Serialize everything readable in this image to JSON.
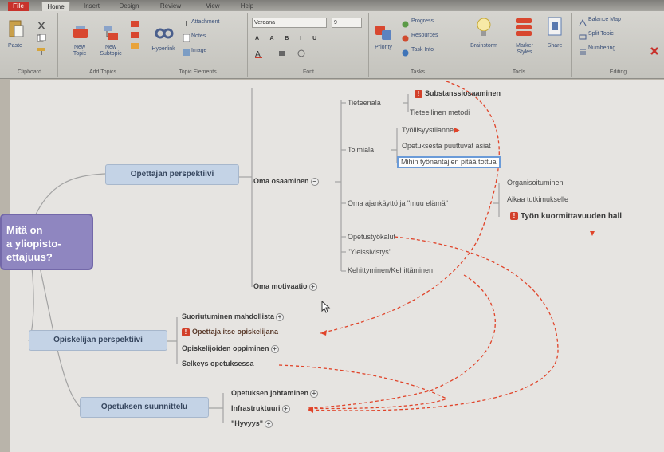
{
  "ribbon_tabs": [
    "File",
    "Home",
    "Insert",
    "Design",
    "Review",
    "View",
    "Help"
  ],
  "groups": {
    "clipboard": {
      "caption": "Clipboard",
      "paste": "Paste"
    },
    "add_topics": {
      "caption": "Add Topics",
      "new_topic": "New Topic",
      "new_subtopic": "New Subtopic"
    },
    "topic_elements": {
      "caption": "Topic Elements",
      "hyperlink": "Hyperlink",
      "attachment": "Attachment",
      "notes": "Notes",
      "image": "Image"
    },
    "font": {
      "caption": "Font",
      "family": "Verdana",
      "size": "9"
    },
    "tasks": {
      "caption": "Tasks",
      "priority": "Priority",
      "progress": "Progress",
      "resources": "Resources",
      "task_info": "Task Info"
    },
    "tools": {
      "caption": "Tools",
      "brainstorm": "Brainstorm",
      "marker_styles": "Marker Styles",
      "share": "Share"
    },
    "editing": {
      "caption": "Editing",
      "balance_map": "Balance Map",
      "split_topic": "Split Topic",
      "numbering": "Numbering"
    }
  },
  "map": {
    "central": [
      "Mitä on",
      "a yliopisto-",
      "ettajuus?"
    ],
    "main_topics": {
      "opettajan": "Opettajan perspektiivi",
      "opiskelijan": "Opiskelijan perspektiivi",
      "opetuksen": "Opetuksen suunnittelu"
    },
    "oma_osaaminen": "Oma osaaminen",
    "oma_motivaatio": "Oma motivaatio",
    "tieteenala": "Tieteenala",
    "substanssi": "Substanssiosaaminen",
    "tieteellinen": "Tieteellinen metodi",
    "toimiala": "Toimiala",
    "tyollisyys": "Työllisyystilanne",
    "opetuksesta": "Opetuksesta puuttuvat asiat",
    "mihin": "Mihin työnantajien pitää tottua",
    "oma_ajankaytto": "Oma ajankäyttö ja \"muu elämä\"",
    "organisoituminen": "Organisoituminen",
    "aikaa": "Aikaa tutkimukselle",
    "tyon": "Työn kuormittavuuden hall",
    "opetustyokalut": "Opetustyökalut",
    "yleissivistys": "\"Yleissivistys\"",
    "kehittyminen": "Kehittyminen/Kehittäminen",
    "suoriutuminen": "Suoriutuminen mahdollista",
    "opettaja_itse": "Opettaja itse opiskelijana",
    "opiskelijoiden": "Opiskelijoiden oppiminen",
    "selkeys": "Selkeys opetuksessa",
    "opetuksen_johtaminen": "Opetuksen johtaminen",
    "infrastruktuuri": "Infrastruktuuri",
    "hyvyys": "\"Hyvyys\""
  },
  "colors": {
    "accent_link": "#e0442a",
    "central_topic": "#8f86c0",
    "main_topic": "#c4d3e6",
    "file_tab": "#c8322c"
  },
  "icons": [
    "paste-icon",
    "new-topic-icon",
    "new-subtopic-icon",
    "hyperlink-icon",
    "attachment-icon",
    "notes-icon",
    "image-icon",
    "priority-icon",
    "progress-icon",
    "resources-icon",
    "task-info-icon",
    "brainstorm-icon",
    "marker-styles-icon",
    "share-icon",
    "balance-map-icon",
    "split-topic-icon",
    "numbering-icon",
    "delete-icon",
    "priority-marker-icon",
    "mouse-pointer-icon"
  ]
}
